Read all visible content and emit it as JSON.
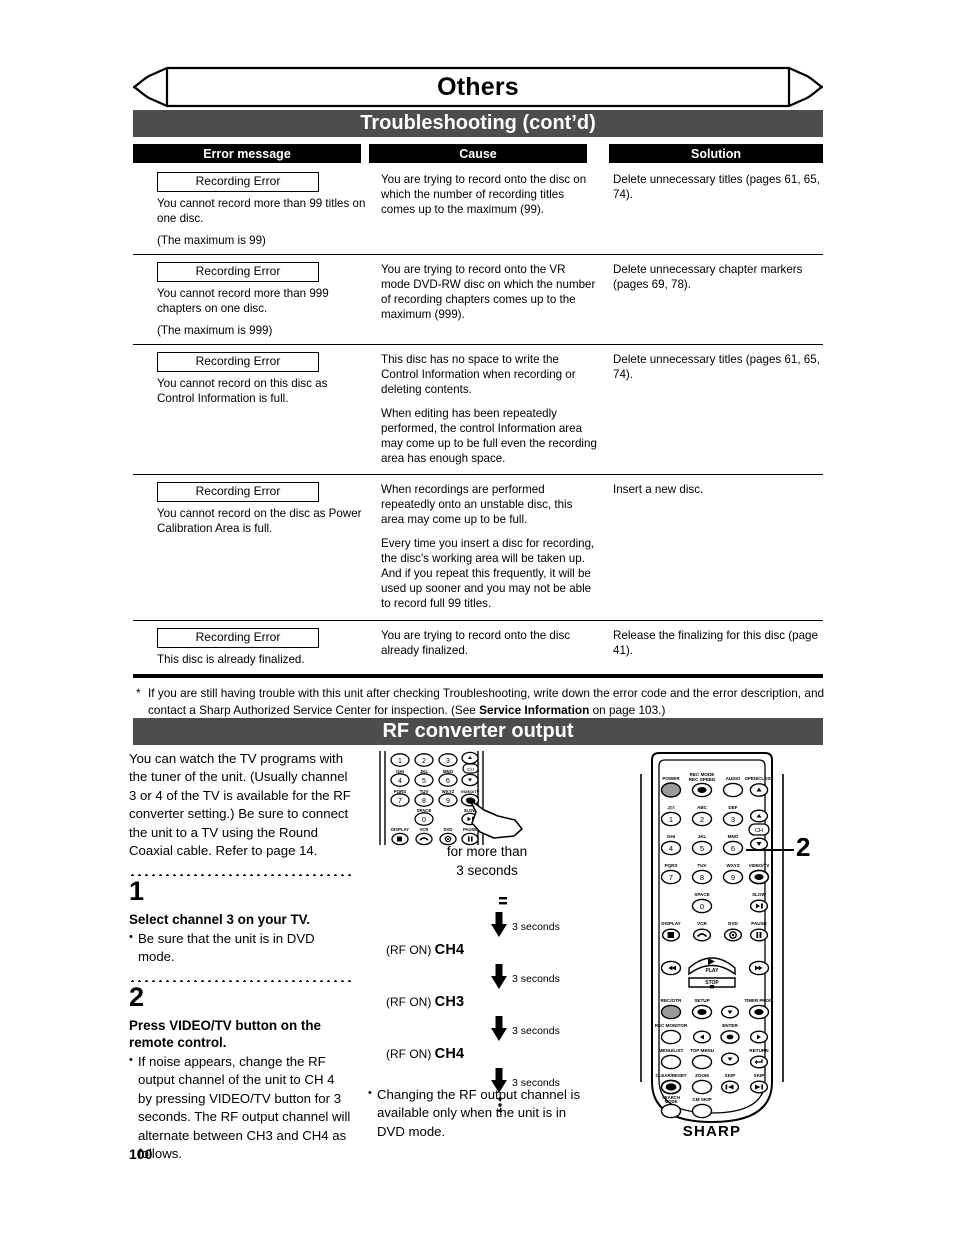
{
  "chapter": {
    "title": "Others"
  },
  "sections": {
    "troubleshooting": {
      "title": "Troubleshooting (cont’d)"
    },
    "rf": {
      "title": "RF converter output"
    }
  },
  "table": {
    "headers": [
      "Error message",
      "Cause",
      "Solution"
    ],
    "rows": [
      {
        "error_box": "Recording Error",
        "error_desc": [
          "You cannot record more than 99 titles on one disc.",
          "(The maximum is 99)"
        ],
        "cause": [
          "You are trying to record onto the disc on which the number of recording titles comes up to the maximum (99)."
        ],
        "solution": [
          "Delete unnecessary titles (pages 61, 65, 74)."
        ]
      },
      {
        "error_box": "Recording Error",
        "error_desc": [
          "You cannot record more than 999 chapters on one disc.",
          "(The maximum is 999)"
        ],
        "cause": [
          "You are trying to record onto the VR mode DVD-RW disc on which the number of recording chapters comes up to the maximum (999)."
        ],
        "solution": [
          "Delete unnecessary chapter markers (pages 69, 78)."
        ]
      },
      {
        "error_box": "Recording Error",
        "error_desc": [
          "You cannot record on this disc as Control Information is full."
        ],
        "cause": [
          "This disc has no space to write the Control Information when recording or deleting contents.",
          "When editing has been repeatedly performed, the control Information area may come up to be full even the recording area has enough space."
        ],
        "solution": [
          "Delete unnecessary titles (pages 61, 65, 74)."
        ]
      },
      {
        "error_box": "Recording Error",
        "error_desc": [
          "You cannot record on the disc as Power Calibration Area is full."
        ],
        "cause": [
          "When recordings are performed repeatedly onto an unstable disc, this area may come up to be full.",
          "Every time you insert a disc for recording, the disc's working area will be taken up. And if you repeat this frequently, it will be used up sooner and you may not be able to record full 99 titles."
        ],
        "solution": [
          "Insert a new disc."
        ]
      },
      {
        "error_box": "Recording Error",
        "error_desc": [
          "This disc is already finalized."
        ],
        "cause": [
          "You are trying to record onto the disc already finalized."
        ],
        "solution": [
          "Release the finalizing for this disc (page 41)."
        ]
      }
    ]
  },
  "footnote": {
    "marker": "*",
    "part1": "If you are still having trouble with this unit after checking Troubleshooting, write down the error code and the error description, and contact a Sharp Authorized Service Center for inspection. (See ",
    "bold": "Service Information",
    "part2": " on page 103.)"
  },
  "rf_body": {
    "intro": "You can watch the TV programs with the tuner of the unit. (Usually channel 3 or 4 of the TV is available for the RF converter setting.) Be sure to connect the unit to a TV using the Round Coaxial cable. Refer to page 14.",
    "steps": [
      {
        "number": "1",
        "heading": "Select channel 3 on your TV.",
        "bullet": "Be sure that the unit is in DVD mode."
      },
      {
        "number": "2",
        "heading": "Press VIDEO/TV button on the remote control.",
        "bullet": "If noise appears, change the RF output channel of the unit to CH 4 by pressing VIDEO/TV button for 3 seconds. The RF output channel will alternate between CH3 and CH4 as follows."
      }
    ],
    "press_caption_line1": "for more than",
    "press_caption_line2": "3 seconds",
    "sequence": {
      "duration_label": "3 seconds",
      "states": [
        {
          "prefix": "(RF ON)",
          "channel": "CH4"
        },
        {
          "prefix": "(RF ON)",
          "channel": "CH3"
        },
        {
          "prefix": "(RF ON)",
          "channel": "CH4"
        }
      ]
    },
    "note": "Changing the RF output channel is available only when the unit is in DVD mode.",
    "callout": "2"
  },
  "remote": {
    "brand": "SHARP",
    "buttons": {
      "power": "POWER",
      "rec_mode": "REC MODE",
      "rec_speed": "REC SPEED",
      "audio": "AUDIO",
      "open_close": "OPEN/CLOSE",
      "key1_letters": ".@/:",
      "key2_letters": "ABC",
      "key3_letters": "DEF",
      "key4_letters": "GHI",
      "key5_letters": "JKL",
      "key6_letters": "MNO",
      "key7_letters": "PQRS",
      "key8_letters": "TUV",
      "key9_letters": "WXYZ",
      "key0_letters": "SPACE",
      "ch": "CH",
      "video_tv": "VIDEO/TV",
      "slow": "SLOW",
      "display": "DISPLAY",
      "vcr": "VCR",
      "dvd": "DVD",
      "pause": "PAUSE",
      "play": "PLAY",
      "stop": "STOP",
      "rec_otr": "REC/OTR",
      "setup": "SETUP",
      "timer_prog": "TIMER PROG.",
      "rec_monitor": "REC MONITOR",
      "enter": "ENTER",
      "menu_list": "MENU/LIST",
      "top_menu": "TOP MENU",
      "return": "RETURN",
      "clear_reset": "CLEAR/RESET",
      "zoom": "ZOOM",
      "skip_back": "SKIP",
      "skip_fwd": "SKIP",
      "search_mode_1": "SEARCH",
      "search_mode_2": "MODE",
      "cm_skip": "CM SKIP"
    },
    "digits": [
      "1",
      "2",
      "3",
      "4",
      "5",
      "6",
      "7",
      "8",
      "9",
      "0"
    ]
  },
  "page_number": "100"
}
